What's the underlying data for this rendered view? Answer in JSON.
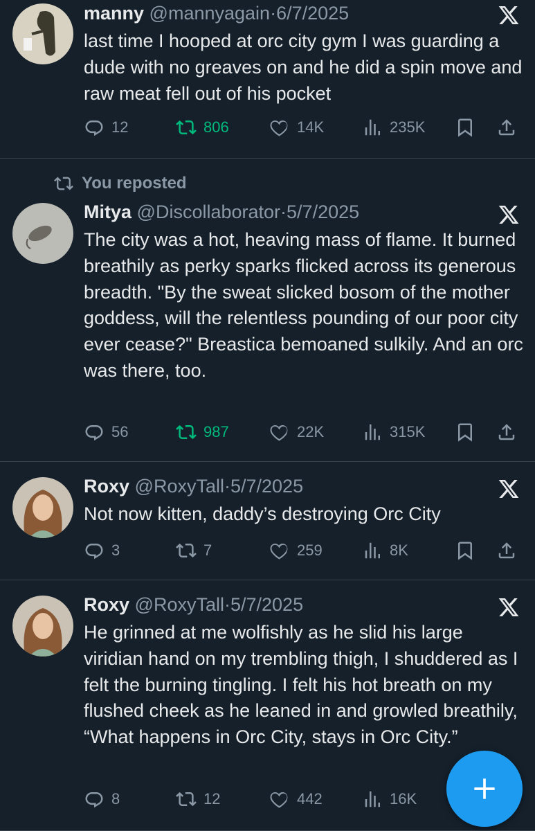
{
  "tweets": [
    {
      "name": "manny",
      "handle": "@mannyagain",
      "date": "6/7/2025",
      "text": "last time I hooped at orc city gym I was guarding a dude with no greaves on and he did a spin move and raw meat fell out of his pocket",
      "replies": "12",
      "reposts": "806",
      "likes": "14K",
      "views": "235K",
      "reposted_by_user": true
    },
    {
      "repost_label": "You reposted",
      "name": "Mitya",
      "handle": "@Discollaborator",
      "date": "5/7/2025",
      "text": "The city was a hot, heaving mass of flame. It burned breathily as perky sparks flicked across its generous breadth. \"By the sweat slicked bosom of the mother goddess, will the relentless pounding of our poor city ever cease?\" Breastica bemoaned sulkily. And an orc was there, too.",
      "replies": "56",
      "reposts": "987",
      "likes": "22K",
      "views": "315K",
      "reposted_by_user": true
    },
    {
      "name": "Roxy",
      "handle": "@RoxyTall",
      "date": "5/7/2025",
      "text": "Not now kitten, daddy’s destroying Orc City",
      "replies": "3",
      "reposts": "7",
      "likes": "259",
      "views": "8K",
      "reposted_by_user": false
    },
    {
      "name": "Roxy",
      "handle": "@RoxyTall",
      "date": "5/7/2025",
      "text": "He grinned at me wolfishly as he slid his large viridian hand on my trembling thigh, I shuddered as I felt the burning tingling. I felt his hot breath on my flushed cheek as he leaned in and growled breathily, “What happens in Orc City, stays in Orc City.”",
      "replies": "8",
      "reposts": "12",
      "likes": "442",
      "views": "16K",
      "reposted_by_user": false
    }
  ],
  "separator": "·",
  "colors": {
    "background": "#15202b",
    "text": "#e7e9ea",
    "muted": "#8b98a5",
    "repost_active": "#00ba7c",
    "fab": "#1d9bf0"
  },
  "icons": [
    "reply-icon",
    "repost-icon",
    "like-icon",
    "views-icon",
    "bookmark-icon",
    "share-icon",
    "x-logo-icon",
    "compose-plus-icon"
  ]
}
